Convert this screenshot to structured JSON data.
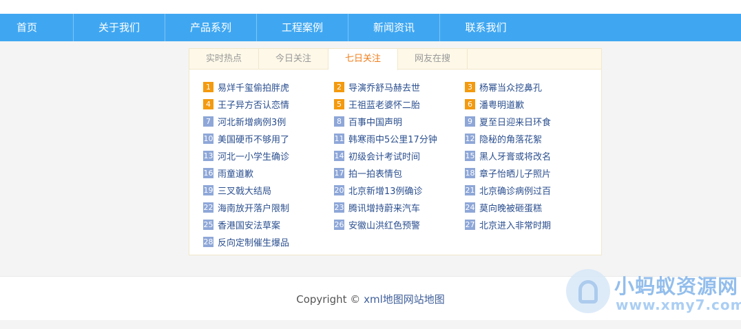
{
  "nav": [
    {
      "label": "首页"
    },
    {
      "label": "关于我们"
    },
    {
      "label": "产品系列"
    },
    {
      "label": "工程案例"
    },
    {
      "label": "新闻资讯"
    },
    {
      "label": "联系我们"
    }
  ],
  "tabs": [
    {
      "label": "实时热点",
      "active": false
    },
    {
      "label": "今日关注",
      "active": false
    },
    {
      "label": "七日关注",
      "active": true
    },
    {
      "label": "网友在搜",
      "active": false
    }
  ],
  "hot_list": [
    {
      "rank": "1",
      "text": "易烊千玺偷拍胖虎"
    },
    {
      "rank": "2",
      "text": "导演乔舒马赫去世"
    },
    {
      "rank": "3",
      "text": "杨幂当众挖鼻孔"
    },
    {
      "rank": "4",
      "text": "王子异方否认恋情"
    },
    {
      "rank": "5",
      "text": "王祖蓝老婆怀二胎"
    },
    {
      "rank": "6",
      "text": "潘粤明道歉"
    },
    {
      "rank": "7",
      "text": "河北新增病例3例"
    },
    {
      "rank": "8",
      "text": "百事中国声明"
    },
    {
      "rank": "9",
      "text": "夏至日迎来日环食"
    },
    {
      "rank": "10",
      "text": "美国硬币不够用了"
    },
    {
      "rank": "11",
      "text": "韩寒雨中5公里17分钟"
    },
    {
      "rank": "12",
      "text": "隐秘的角落花絮"
    },
    {
      "rank": "13",
      "text": "河北一小学生确诊"
    },
    {
      "rank": "14",
      "text": "初级会计考试时间"
    },
    {
      "rank": "15",
      "text": "黑人牙膏或将改名"
    },
    {
      "rank": "16",
      "text": "雨童道歉"
    },
    {
      "rank": "17",
      "text": "拍一拍表情包"
    },
    {
      "rank": "18",
      "text": "章子怡晒儿子照片"
    },
    {
      "rank": "19",
      "text": "三叉戟大结局"
    },
    {
      "rank": "20",
      "text": "北京新增13例确诊"
    },
    {
      "rank": "21",
      "text": "北京确诊病例过百"
    },
    {
      "rank": "22",
      "text": "海南放开落户限制"
    },
    {
      "rank": "23",
      "text": "腾讯增持蔚来汽车"
    },
    {
      "rank": "24",
      "text": "莫向晚被砸蛋糕"
    },
    {
      "rank": "25",
      "text": "香港国安法草案"
    },
    {
      "rank": "26",
      "text": "安徽山洪红色预警"
    },
    {
      "rank": "27",
      "text": "北京进入非常时期"
    },
    {
      "rank": "28",
      "text": "反向定制催生爆品"
    }
  ],
  "footer": {
    "prefix": "Copyright © ",
    "link1": "xml地图",
    "link2": "网站地图"
  },
  "watermark": {
    "title": "小蚂蚁资源网",
    "url": "www.xmy7.com"
  },
  "colors": {
    "nav_bg": "#3fa7f2",
    "active_tab": "#f07d1a",
    "top_badge": "#f39a0f",
    "badge": "#8ea7d8",
    "link": "#2b4f8f"
  }
}
